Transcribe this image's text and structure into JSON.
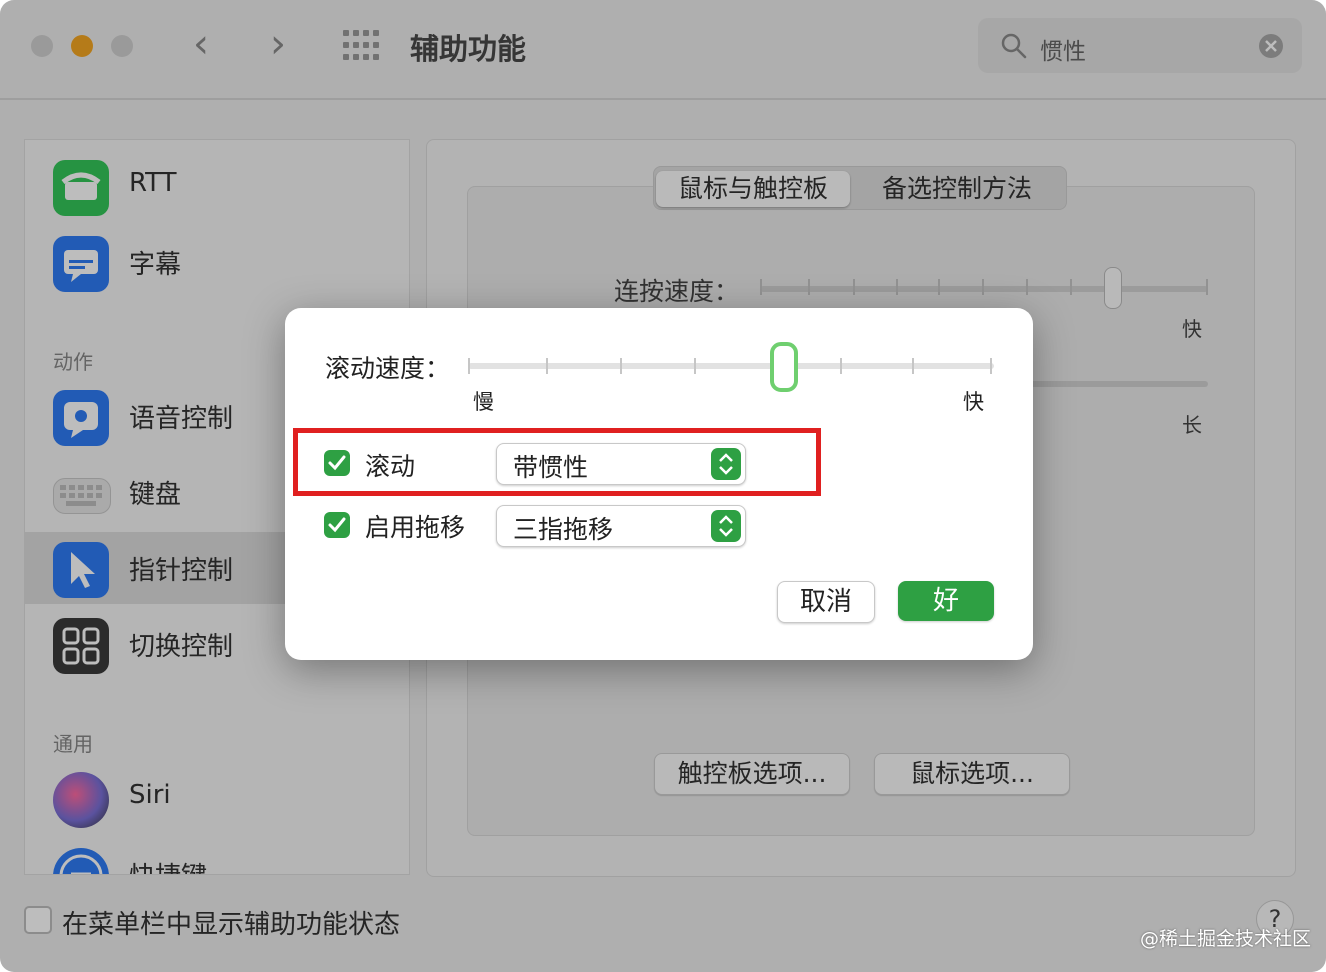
{
  "window": {
    "title": "辅助功能",
    "nav_back": "‹",
    "nav_forward": "›",
    "search": {
      "value": "惯性"
    }
  },
  "sidebar": {
    "items": [
      {
        "label": "RTT",
        "icon": "rtt-phone-icon",
        "color": "#34c759"
      },
      {
        "label": "字幕",
        "icon": "captions-icon",
        "color": "#2f7bf5"
      },
      {
        "label": "语音控制",
        "icon": "voice-control-icon",
        "color": "#2f7bf5"
      },
      {
        "label": "键盘",
        "icon": "keyboard-icon",
        "color": "#c8c8c8"
      },
      {
        "label": "指针控制",
        "icon": "pointer-icon",
        "color": "#2f7bf5",
        "selected": true
      },
      {
        "label": "切换控制",
        "icon": "switch-control-icon",
        "color": "#3a3a3a"
      },
      {
        "label": "Siri",
        "icon": "siri-icon",
        "color": "#7a6fd6"
      },
      {
        "label": "快捷键",
        "icon": "shortcut-icon",
        "color": "#2f7bf5"
      }
    ],
    "section_action": "动作",
    "section_general": "通用"
  },
  "main": {
    "tabs": [
      {
        "label": "鼠标与触控板",
        "active": true
      },
      {
        "label": "备选控制方法",
        "active": false
      }
    ],
    "double_click_label": "连按速度：",
    "fast_label": "快",
    "long_label": "长",
    "trackpad_options_button": "触控板选项...",
    "mouse_options_button": "鼠标选项..."
  },
  "footer": {
    "menu_bar_checkbox_label": "在菜单栏中显示辅助功能状态",
    "menu_bar_checked": false,
    "help": "?"
  },
  "dialog": {
    "scroll_speed_label": "滚动速度：",
    "slow_label": "慢",
    "fast_label": "快",
    "scroll_speed_level": 0.6,
    "scrolling": {
      "label": "滚动",
      "checked": true,
      "value": "带惯性"
    },
    "dragging": {
      "label": "启用拖移",
      "checked": true,
      "value": "三指拖移"
    },
    "cancel_button": "取消",
    "ok_button": "好"
  },
  "watermark": "@稀土掘金技术社区",
  "colors": {
    "accent_green": "#2ea043",
    "highlight_red": "#e02020"
  }
}
